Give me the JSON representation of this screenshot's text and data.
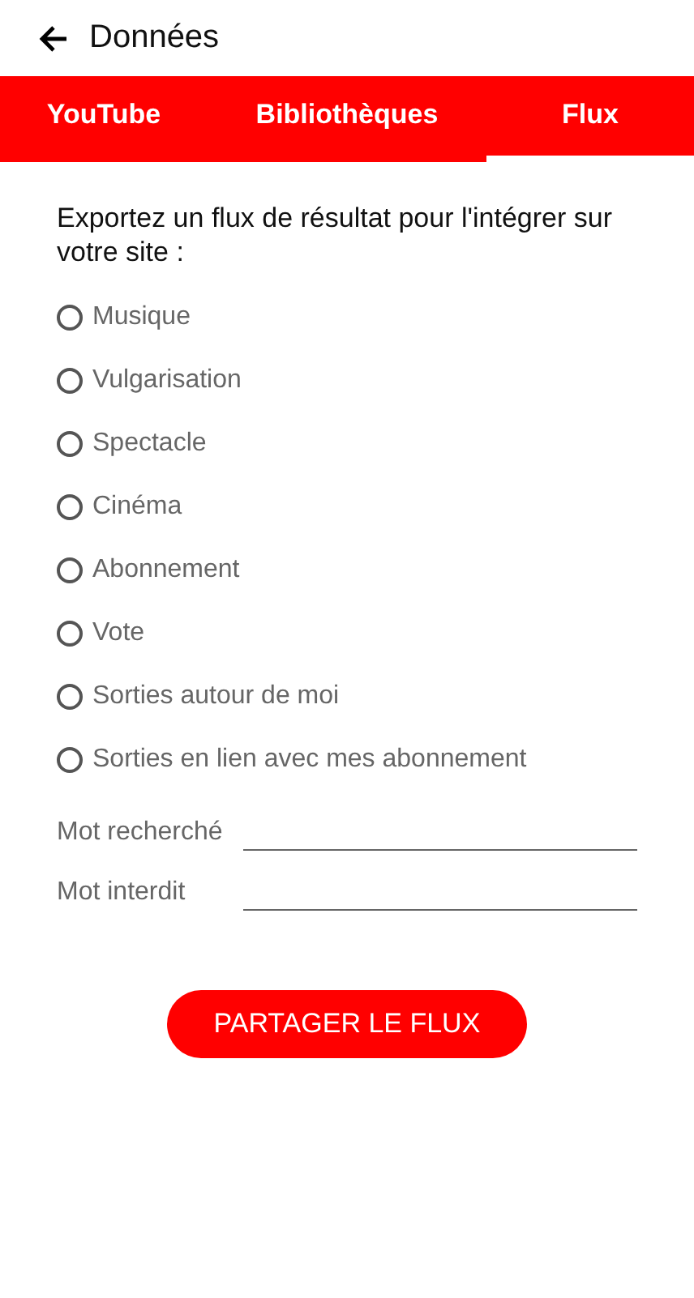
{
  "header": {
    "title": "Données"
  },
  "tabs": [
    {
      "label": "YouTube",
      "selected": false
    },
    {
      "label": "Bibliothèques",
      "selected": false
    },
    {
      "label": "Flux",
      "selected": true
    }
  ],
  "intro": "Exportez un flux de résultat pour l'intégrer sur votre site :",
  "options": [
    {
      "label": "Musique",
      "selected": false
    },
    {
      "label": "Vulgarisation",
      "selected": false
    },
    {
      "label": "Spectacle",
      "selected": false
    },
    {
      "label": "Cinéma",
      "selected": false
    },
    {
      "label": "Abonnement",
      "selected": false
    },
    {
      "label": "Vote",
      "selected": false
    },
    {
      "label": "Sorties autour de moi",
      "selected": false
    },
    {
      "label": "Sorties en lien avec mes abonnement",
      "selected": false
    }
  ],
  "fields": [
    {
      "label": "Mot recherché"
    },
    {
      "label": "Mot interdit"
    }
  ],
  "share_button": "PARTAGER LE FLUX"
}
